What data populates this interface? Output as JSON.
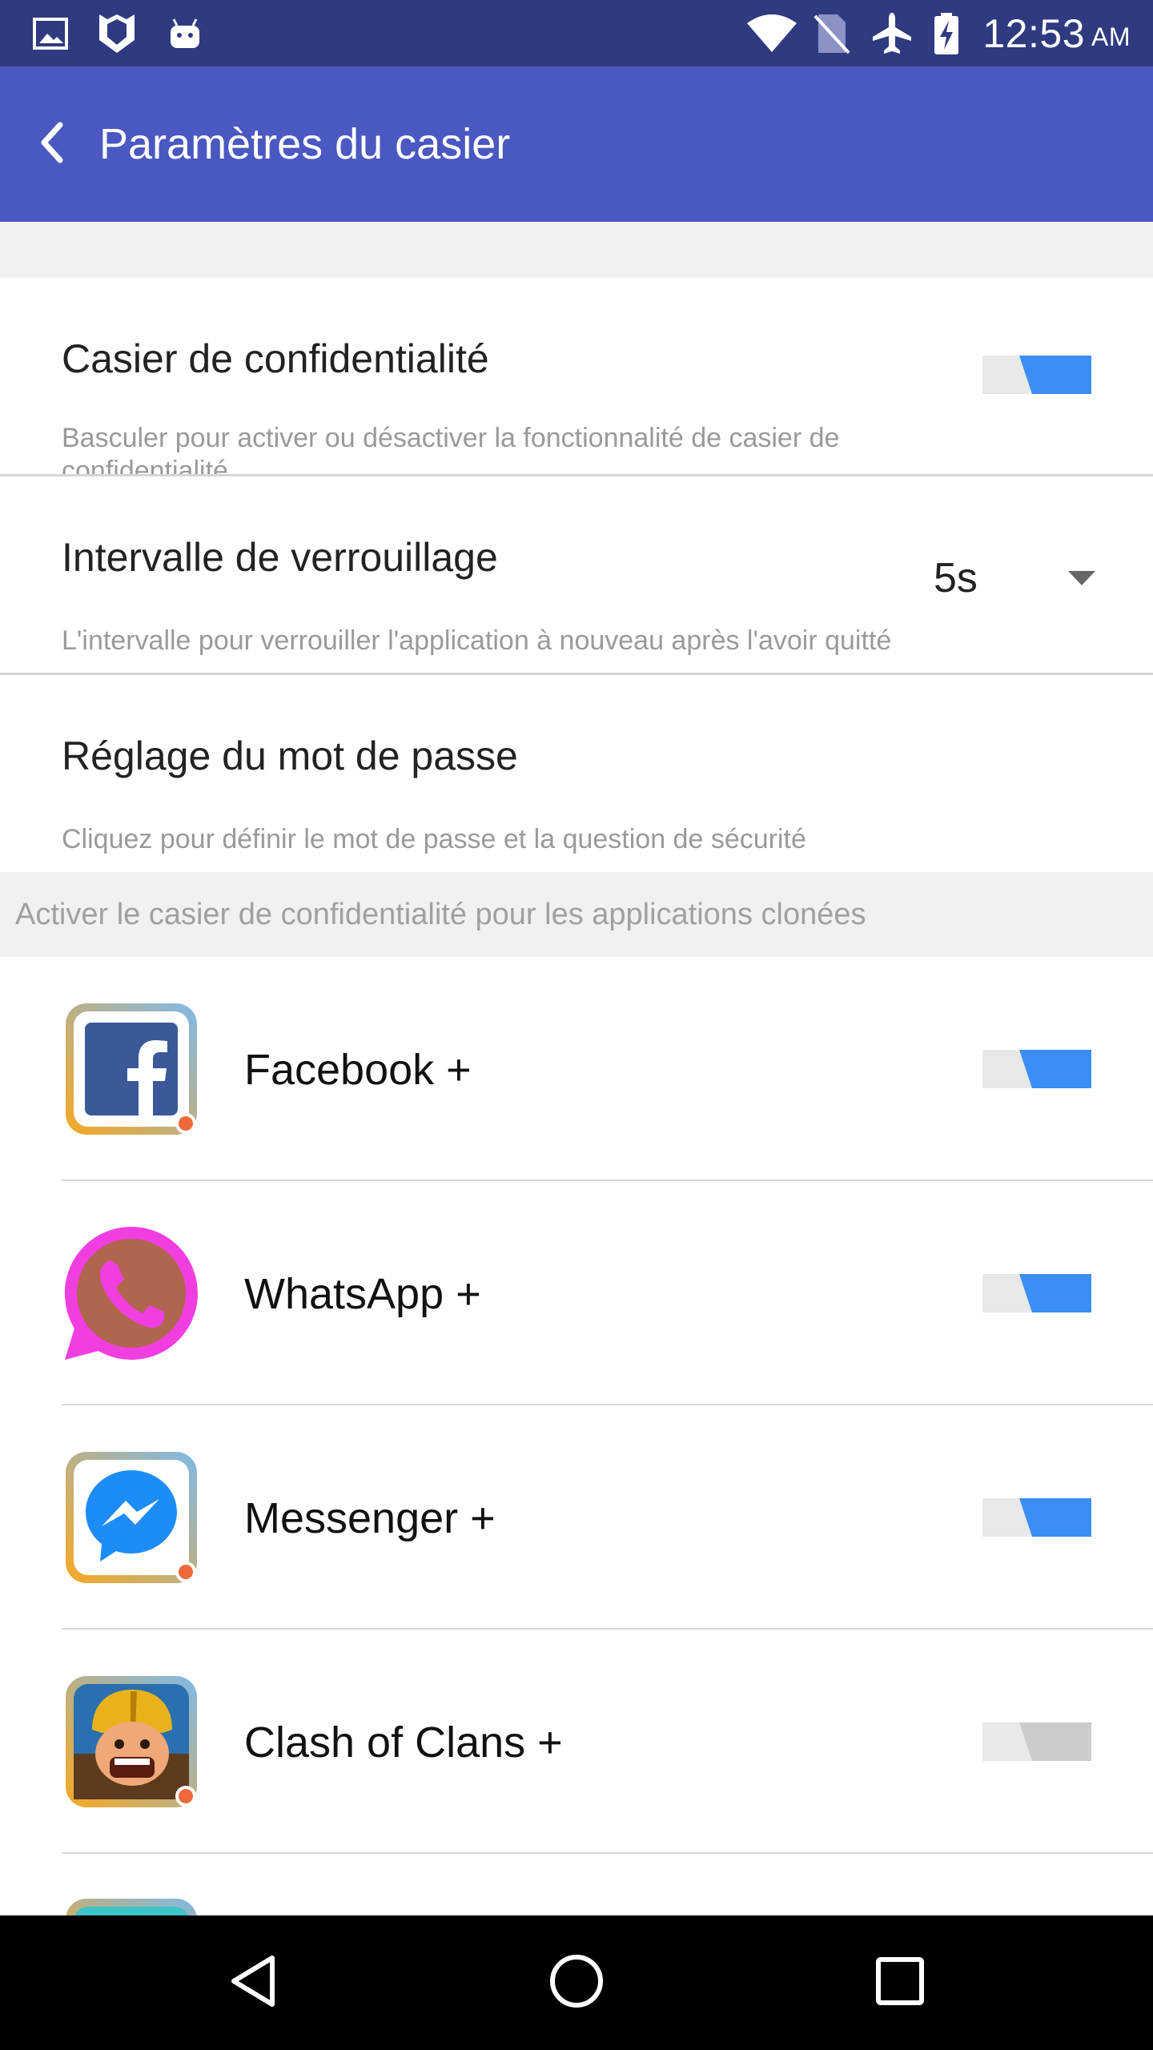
{
  "status_bar": {
    "time": "12:53",
    "ampm": "AM",
    "icons": [
      "image-icon",
      "shield-app-icon",
      "android-icon",
      "wifi-icon",
      "no-sim-icon",
      "airplane-mode-icon",
      "battery-charging-icon"
    ]
  },
  "app_bar": {
    "title": "Paramètres du casier",
    "back_icon": "chevron-left-icon"
  },
  "settings": {
    "privacy_locker": {
      "title": "Casier de confidentialité",
      "description": "Basculer pour activer ou désactiver la fonctionnalité de casier de confidentialité",
      "enabled": true
    },
    "lock_interval": {
      "title": "Intervalle de verrouillage",
      "description": "L'intervalle pour verrouiller l'application à nouveau après l'avoir quitté",
      "value": "5s"
    },
    "password": {
      "title": "Réglage du mot de passe",
      "description": "Cliquez pour définir le mot de passe et la question de sécurité"
    }
  },
  "section_header": "Activer le casier de confidentialité pour les applications clonées",
  "apps": [
    {
      "name": "Facebook +",
      "icon": "facebook-icon",
      "enabled": true
    },
    {
      "name": "WhatsApp +",
      "icon": "whatsapp-icon",
      "enabled": true
    },
    {
      "name": "Messenger +",
      "icon": "messenger-icon",
      "enabled": true
    },
    {
      "name": "Clash of Clans +",
      "icon": "clash-of-clans-icon",
      "enabled": false
    }
  ],
  "colors": {
    "status_bar": "#2f3a80",
    "app_bar": "#4a58c1",
    "toggle_on": "#3b8ef5",
    "toggle_off": "#cccccc",
    "toggle_track": "#e8e8e8"
  },
  "nav_bar": {
    "icons": [
      "back-triangle-icon",
      "home-circle-icon",
      "recents-square-icon"
    ]
  }
}
